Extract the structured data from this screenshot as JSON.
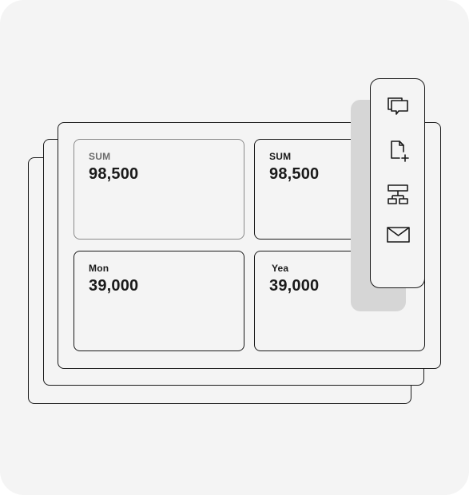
{
  "cards": [
    {
      "label": "SUM",
      "value": "98,500",
      "muted": true
    },
    {
      "label": "SUM",
      "value": "98,500"
    },
    {
      "label": "Mon",
      "value": "39,000"
    },
    {
      "label": "Yea",
      "value": "39,000"
    }
  ],
  "toolbar": {
    "icons": [
      "chat-bubbles-icon",
      "add-document-icon",
      "hierarchy-icon",
      "mail-icon"
    ]
  },
  "colors": {
    "background": "#f4f4f4",
    "outline": "#1a1a1a",
    "muted_outline": "#8a8a8a",
    "shadow": "#d6d6d6"
  }
}
